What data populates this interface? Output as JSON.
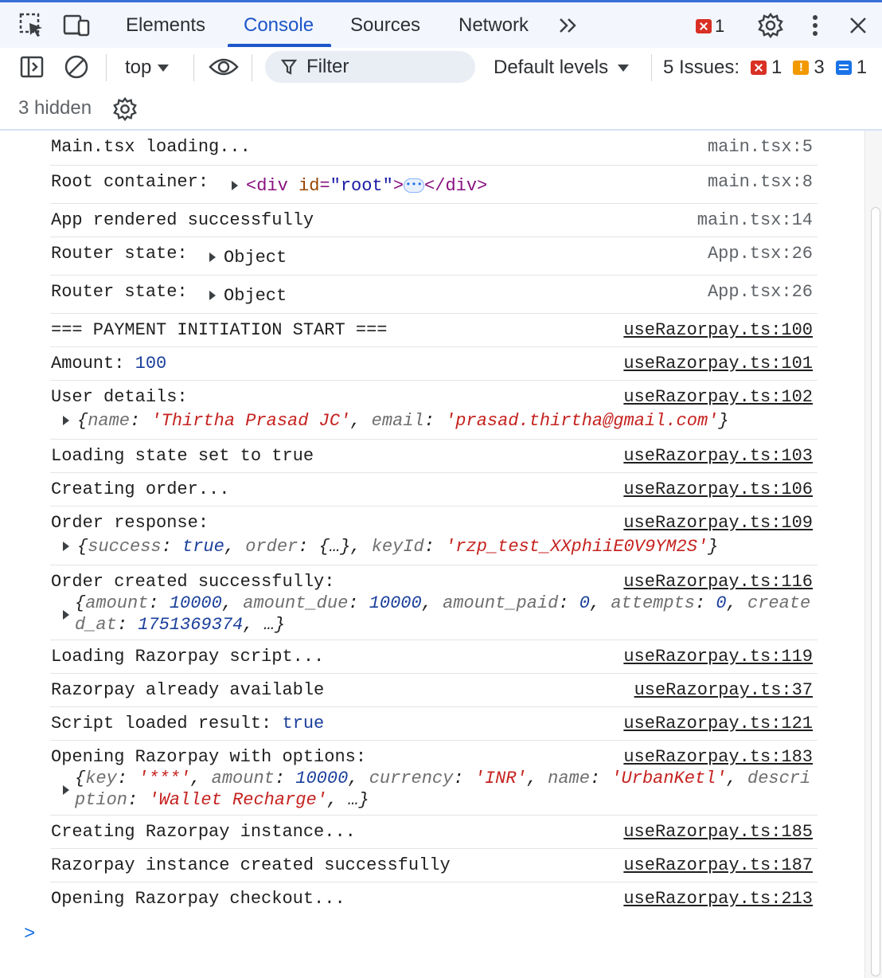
{
  "tabbar": {
    "tabs": [
      "Elements",
      "Console",
      "Sources",
      "Network"
    ],
    "active_tab": "Console",
    "more_tabs": "»",
    "error_count": "1"
  },
  "toolbar": {
    "context": "top",
    "filter_placeholder": "Filter",
    "levels": "Default levels",
    "issues_label": "5 Issues:",
    "issues_errors": "1",
    "issues_warnings": "3",
    "issues_info": "1",
    "hidden": "3 hidden"
  },
  "console": {
    "rows": [
      {
        "msg": "Main.tsx loading...",
        "src": "main.tsx:5"
      },
      {
        "msg": "Root container: ",
        "element": "<div id=\"root\">",
        "element_close": "</div>",
        "src": "main.tsx:8"
      },
      {
        "msg": "App rendered successfully",
        "src": "main.tsx:14"
      },
      {
        "msg": "Router state: ",
        "obj": "Object",
        "src": "App.tsx:26"
      },
      {
        "msg": "Router state: ",
        "obj": "Object",
        "src": "App.tsx:26"
      },
      {
        "msg": "=== PAYMENT INITIATION START ===",
        "src": "useRazorpay.ts:100"
      },
      {
        "msg": "Amount: ",
        "value": "100",
        "src": "useRazorpay.ts:101"
      },
      {
        "msg": "User details:",
        "src": "useRazorpay.ts:102",
        "detail": "{name: 'Thirtha Prasad JC', email: 'prasad.thirtha@gmail.com'}"
      },
      {
        "msg": "Loading state set to true",
        "src": "useRazorpay.ts:103"
      },
      {
        "msg": "Creating order...",
        "src": "useRazorpay.ts:106"
      },
      {
        "msg": "Order response:",
        "src": "useRazorpay.ts:109",
        "detail": "{success: true, order: {…}, keyId: 'rzp_test_XXphiiE0V9YM2S'}"
      },
      {
        "msg": "Order created successfully:",
        "src": "useRazorpay.ts:116",
        "detail": "{amount: 10000, amount_due: 10000, amount_paid: 0, attempts: 0, created_at: 1751369374, …}"
      },
      {
        "msg": "Loading Razorpay script...",
        "src": "useRazorpay.ts:119"
      },
      {
        "msg": "Razorpay already available",
        "src": "useRazorpay.ts:37"
      },
      {
        "msg": "Script loaded result: ",
        "value": "true",
        "src": "useRazorpay.ts:121"
      },
      {
        "msg": "Opening Razorpay with options:",
        "src": "useRazorpay.ts:183",
        "detail": "{key: '***', amount: 10000, currency: 'INR', name: 'UrbanKetl', description: 'Wallet Recharge', …}"
      },
      {
        "msg": "Creating Razorpay instance...",
        "src": "useRazorpay.ts:185"
      },
      {
        "msg": "Razorpay instance created successfully",
        "src": "useRazorpay.ts:187"
      },
      {
        "msg": "Opening Razorpay checkout...",
        "src": "useRazorpay.ts:213"
      }
    ],
    "prompt": ">"
  },
  "colors": {
    "accent": "#1c56c9",
    "error": "#d93025",
    "warning": "#f29900",
    "info": "#1a73e8"
  }
}
